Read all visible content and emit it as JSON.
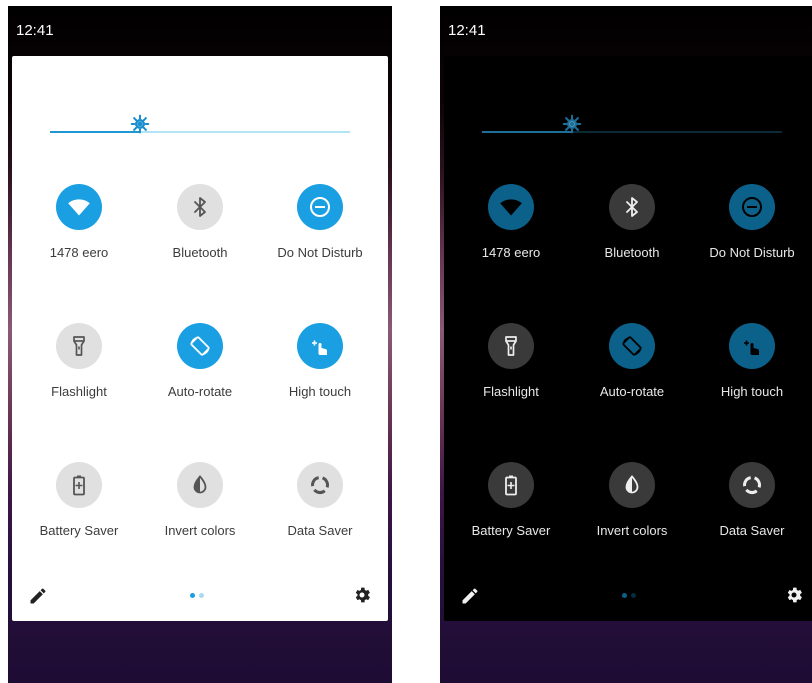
{
  "status_time": "12:41",
  "brightness_level": 0.3,
  "tiles": [
    {
      "label": "1478 eero",
      "icon": "wifi-icon",
      "active": true
    },
    {
      "label": "Bluetooth",
      "icon": "bluetooth-icon",
      "active": false
    },
    {
      "label": "Do Not Disturb",
      "icon": "do-not-disturb-icon",
      "active": true
    },
    {
      "label": "Flashlight",
      "icon": "flashlight-icon",
      "active": false
    },
    {
      "label": "Auto-rotate",
      "icon": "auto-rotate-icon",
      "active": true
    },
    {
      "label": "High touch",
      "icon": "high-touch-icon",
      "active": true
    },
    {
      "label": "Battery Saver",
      "icon": "battery-saver-icon",
      "active": false
    },
    {
      "label": "Invert colors",
      "icon": "invert-colors-icon",
      "active": false
    },
    {
      "label": "Data Saver",
      "icon": "data-saver-icon",
      "active": false
    }
  ],
  "page_indicator": {
    "current": 1,
    "total": 2
  },
  "footer": {
    "edit_icon": "pencil-icon",
    "settings_icon": "gear-icon"
  },
  "colors": {
    "accent_light": "#1aa0e2",
    "accent_dark": "#0b618a",
    "inactive_light": "#e0e0e0",
    "inactive_dark": "#3a3a3a"
  }
}
